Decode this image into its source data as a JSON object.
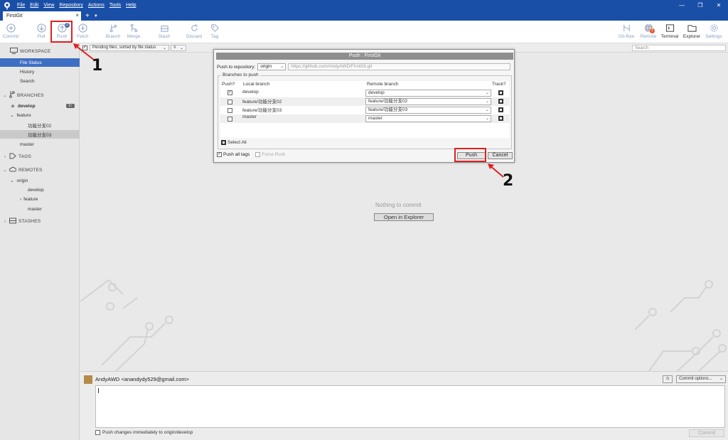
{
  "menu": [
    "File",
    "Edit",
    "View",
    "Repository",
    "Actions",
    "Tools",
    "Help"
  ],
  "tab": {
    "title": "FirstGit"
  },
  "toolbar": {
    "commit": "Commit",
    "pull": "Pull",
    "push": "Push",
    "push_badge": "2",
    "fetch": "Fetch",
    "branch": "Branch",
    "merge": "Merge",
    "stash": "Stash",
    "discard": "Discard",
    "tag": "Tag",
    "gitflow": "Git-flow",
    "remote": "Remote",
    "remote_badge": "1",
    "terminal": "Terminal",
    "explorer": "Explorer",
    "settings": "Settings"
  },
  "sidebar": {
    "workspace": "WORKSPACE",
    "file_status": "File Status",
    "history": "History",
    "search": "Search",
    "branches": "BRANCHES",
    "develop": "develop",
    "develop_badge": "2↑",
    "feature": "feature",
    "feature_a": "功能分支02",
    "feature_b": "功能分支03",
    "master": "master",
    "tags": "TAGS",
    "remotes": "REMOTES",
    "origin": "origin",
    "origin_develop": "develop",
    "origin_feature": "feature",
    "origin_master": "master",
    "stashes": "STASHES"
  },
  "filter": {
    "label": "Pending files, sorted by file status",
    "search_placeholder": "Search"
  },
  "main": {
    "nothing": "Nothing to commit",
    "open_explorer": "Open in Explorer"
  },
  "commit": {
    "author": "AndyAWD <anandydy529@gmail.com>",
    "push_immediately": "Push changes immediately to origin/develop",
    "commit_button": "Commit",
    "options": "Commit options..."
  },
  "dialog": {
    "title": "Push : FirstGit",
    "push_to_label": "Push to repository:",
    "remote": "origin",
    "url": "https://github.com/AndyAWD/FirstGit.git",
    "branches_label": "Branches to push",
    "col_push": "Push?",
    "col_local": "Local branch",
    "col_remote": "Remote branch",
    "col_track": "Track?",
    "rows": [
      {
        "local": "develop",
        "remote": "develop",
        "push": true
      },
      {
        "local": "feature/功能分支02",
        "remote": "feature/功能分支02",
        "push": false
      },
      {
        "local": "feature/功能分支03",
        "remote": "feature/功能分支03",
        "push": false
      },
      {
        "local": "master",
        "remote": "master",
        "push": false
      }
    ],
    "select_all": "Select All",
    "push_all_tags": "Push all tags",
    "force_push": "Force Push",
    "push_button": "Push",
    "cancel_button": "Cancel"
  },
  "annotations": {
    "one": "1",
    "two": "2",
    "color": "#e02020"
  }
}
